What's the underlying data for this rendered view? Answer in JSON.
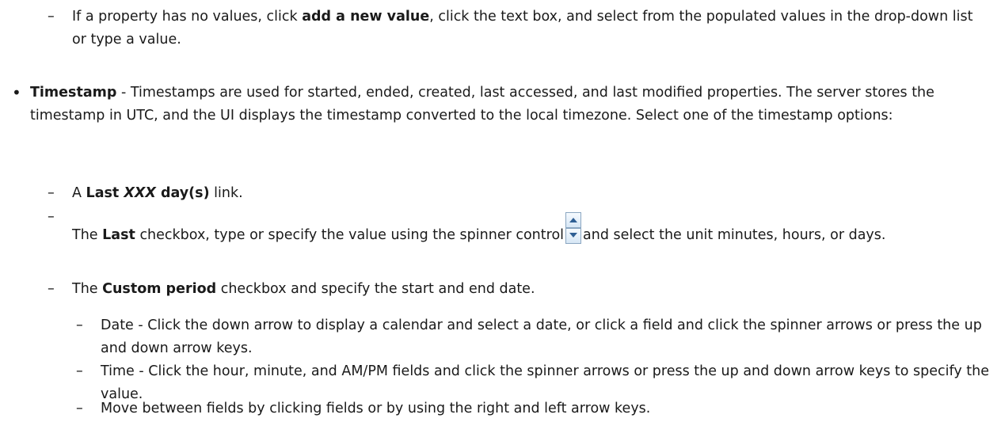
{
  "doc": {
    "property_no_values": {
      "dash": "–",
      "prefix": "If a property has no values, click ",
      "bold": "add a new value",
      "suffix": ", click the text box, and select from the populated values in the drop-down list or type a value."
    },
    "timestamp": {
      "bullet": "•",
      "term": "Timestamp",
      "desc": " - Timestamps are used for started, ended, created, last accessed, and last modified properties. The server stores the timestamp in UTC, and the UI displays the timestamp converted to the local timezone. Select one of the timestamp options:"
    },
    "options": {
      "last_xxx": {
        "dash": "–",
        "a": "A ",
        "bold1": "Last ",
        "italic": "XXX",
        "bold2": " day(s)",
        "suffix": " link."
      },
      "last_checkbox": {
        "dash": "–",
        "prefix": "The ",
        "bold": "Last",
        "middle": " checkbox, type or specify the value using the spinner control",
        "suffix": "and select the unit minutes, hours, or days.",
        "spinner_icon": "spinner-icon"
      },
      "custom_period": {
        "dash": "–",
        "prefix": "The ",
        "bold": "Custom period",
        "suffix": " checkbox and specify the start and end date."
      }
    },
    "sub_options": {
      "date": {
        "dash": "–",
        "text": "Date - Click the down arrow to display a calendar and select a date, or click a field and click the spinner arrows or press the up and down arrow keys."
      },
      "time": {
        "dash": "–",
        "text": "Time - Click the hour, minute, and AM/PM fields and click the spinner arrows or press the up and down arrow keys to specify the value."
      },
      "move": {
        "dash": "–",
        "text": "Move between fields by clicking fields or by using the right and left arrow keys."
      }
    }
  }
}
